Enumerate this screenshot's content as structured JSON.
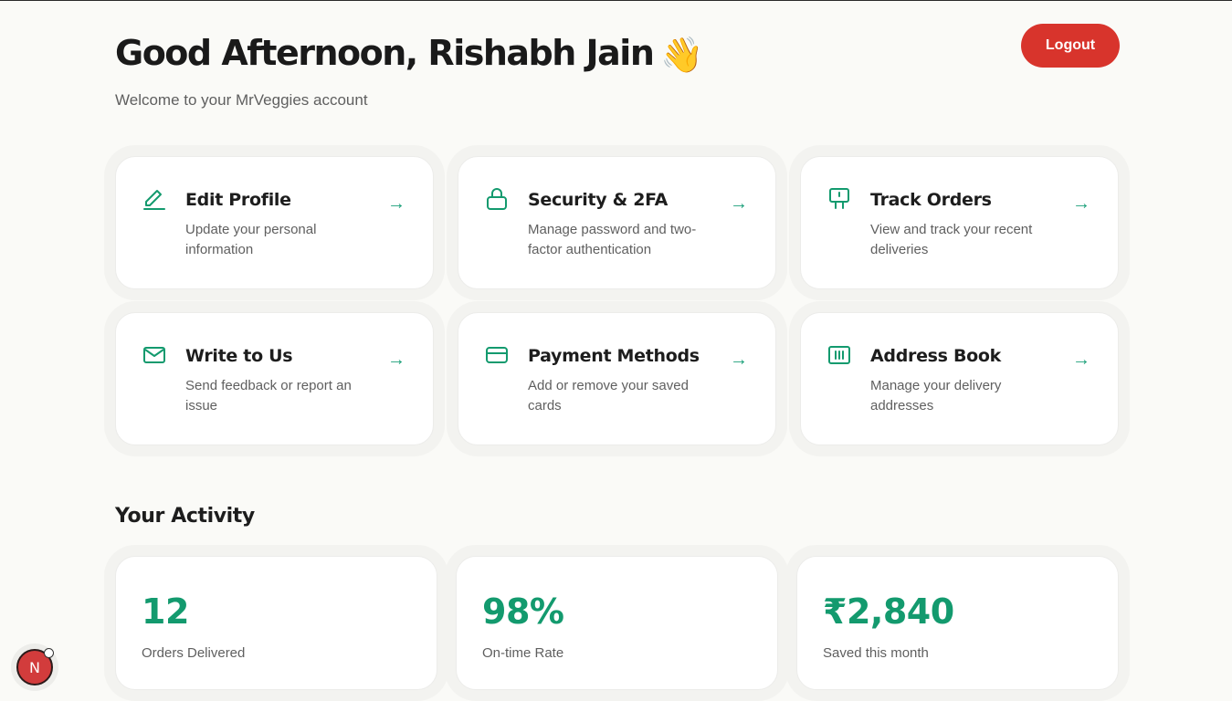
{
  "header": {
    "greeting": "Good Afternoon, Rishabh Jain",
    "greeting_emoji": "👋",
    "welcome": "Welcome to your MrVeggies account",
    "logout_label": "Logout"
  },
  "colors": {
    "accent": "#139a6e",
    "danger": "#d8342c",
    "background": "#fafaf7"
  },
  "cards": [
    {
      "icon": "pencil-icon",
      "title": "Edit Profile",
      "desc": "Update your personal information",
      "arrow": "→"
    },
    {
      "icon": "lock-icon",
      "title": "Security & 2FA",
      "desc": "Manage password and two-factor authentication",
      "arrow": "→"
    },
    {
      "icon": "signpost-icon",
      "title": "Track Orders",
      "desc": "View and track your recent deliveries",
      "arrow": "→"
    },
    {
      "icon": "mail-icon",
      "title": "Write to Us",
      "desc": "Send feedback or report an issue",
      "arrow": "→"
    },
    {
      "icon": "credit-card-icon",
      "title": "Payment Methods",
      "desc": "Add or remove your saved cards",
      "arrow": "→"
    },
    {
      "icon": "address-book-icon",
      "title": "Address Book",
      "desc": "Manage your delivery addresses",
      "arrow": "→"
    }
  ],
  "activity": {
    "title": "Your Activity",
    "stats": [
      {
        "value": "12",
        "label": "Orders Delivered"
      },
      {
        "value": "98%",
        "label": "On-time Rate"
      },
      {
        "value": "₹2,840",
        "label": "Saved this month"
      }
    ]
  },
  "dev_badge": {
    "letter": "N"
  }
}
